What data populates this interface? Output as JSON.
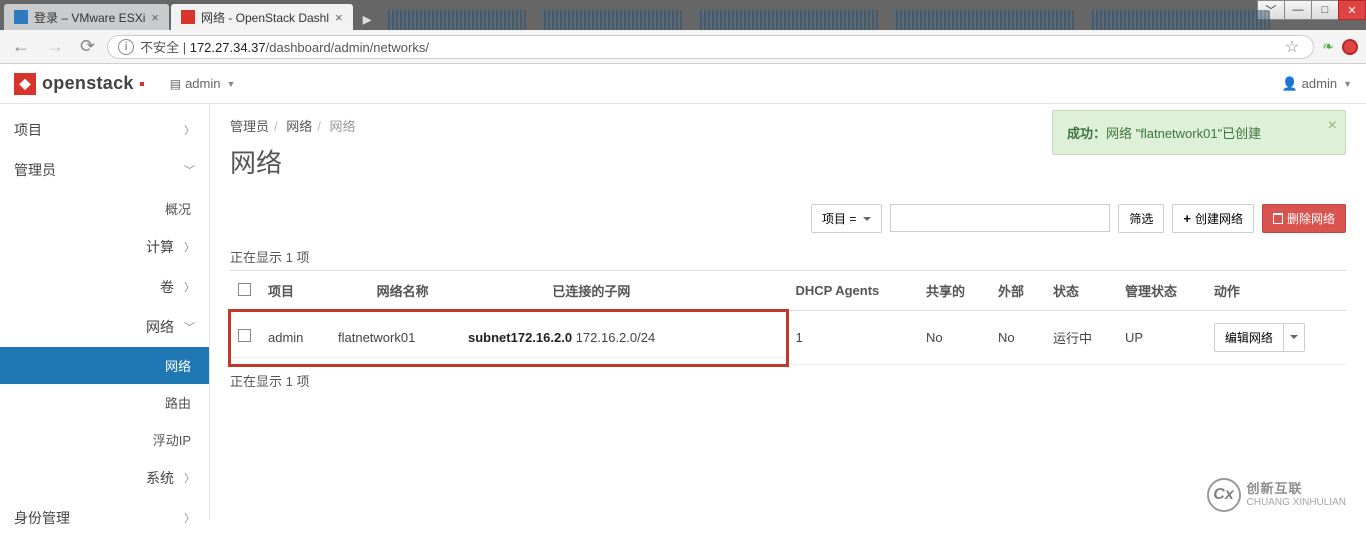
{
  "browser": {
    "tabs": [
      {
        "title": "登录 – VMware ESXi",
        "active": false
      },
      {
        "title": "网络 - OpenStack Dashl",
        "active": true
      }
    ],
    "url_insecure_label": "不安全",
    "url_domain": "172.27.34.37",
    "url_path": "/dashboard/admin/networks/"
  },
  "topbar": {
    "brand": "openstack",
    "context": "admin",
    "user": "admin"
  },
  "sidebar": {
    "project": "项目",
    "admin": "管理员",
    "overview": "概况",
    "compute": "计算",
    "volume": "卷",
    "network": "网络",
    "network_sub": "网络",
    "router": "路由",
    "floating_ip": "浮动IP",
    "system": "系统",
    "identity": "身份管理"
  },
  "alert": {
    "prefix": "成功：",
    "text": "网络 \"flatnetwork01\"已创建"
  },
  "breadcrumb": {
    "admin": "管理员",
    "network": "网络",
    "current": "网络"
  },
  "page_title": "网络",
  "toolbar": {
    "project_filter": "项目 =",
    "filter": "筛选",
    "create": "创建网络",
    "delete": "删除网络"
  },
  "count_top": "正在显示 1 项",
  "count_bottom": "正在显示 1 项",
  "columns": {
    "project": "项目",
    "name": "网络名称",
    "subnets": "已连接的子网",
    "dhcp": "DHCP Agents",
    "shared": "共享的",
    "external": "外部",
    "status": "状态",
    "admin_state": "管理状态",
    "actions": "动作"
  },
  "rows": [
    {
      "project": "admin",
      "name": "flatnetwork01",
      "subnet_name": "subnet172.16.2.0",
      "subnet_cidr": "172.16.2.0/24",
      "dhcp": "1",
      "shared": "No",
      "external": "No",
      "status": "运行中",
      "admin_state": "UP",
      "action_label": "编辑网络"
    }
  ],
  "watermark": {
    "brand": "创新互联",
    "sub": "CHUANG XINHULIAN"
  }
}
